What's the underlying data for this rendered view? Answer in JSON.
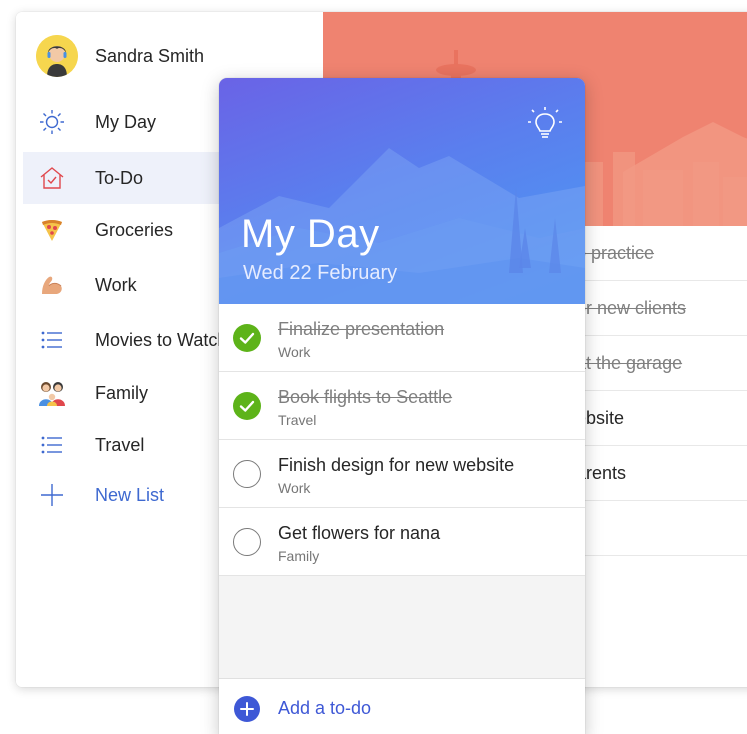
{
  "sidebar": {
    "user_name": "Sandra Smith",
    "items": [
      {
        "label": "My Day",
        "icon": "sun-icon"
      },
      {
        "label": "To-Do",
        "icon": "home-check-icon"
      },
      {
        "label": "Groceries",
        "icon": "pizza-icon"
      },
      {
        "label": "Work",
        "icon": "flexed-biceps-icon"
      },
      {
        "label": "Movies to Watch",
        "icon": "list-icon"
      },
      {
        "label": "Family",
        "icon": "family-icon"
      },
      {
        "label": "Travel",
        "icon": "list-icon"
      },
      {
        "label": "New List",
        "icon": "plus-icon"
      }
    ]
  },
  "background_list": {
    "rows": [
      {
        "text": "o practice",
        "done": true
      },
      {
        "text": "or new clients",
        "done": true
      },
      {
        "text": "at the garage",
        "done": true
      },
      {
        "text": "ebsite",
        "done": false
      },
      {
        "text": "arents",
        "done": false
      }
    ]
  },
  "my_day": {
    "title": "My Day",
    "date": "Wed 22 February",
    "tasks": [
      {
        "title": "Finalize presentation",
        "list": "Work",
        "done": true
      },
      {
        "title": "Book flights to Seattle",
        "list": "Travel",
        "done": true
      },
      {
        "title": "Finish design for new website",
        "list": "Work",
        "done": false
      },
      {
        "title": "Get flowers for nana",
        "list": "Family",
        "done": false
      }
    ],
    "add_label": "Add a to-do"
  },
  "colors": {
    "accent": "#3e58d6",
    "done_green": "#5db319",
    "hero_back": "#ee7d6b"
  }
}
